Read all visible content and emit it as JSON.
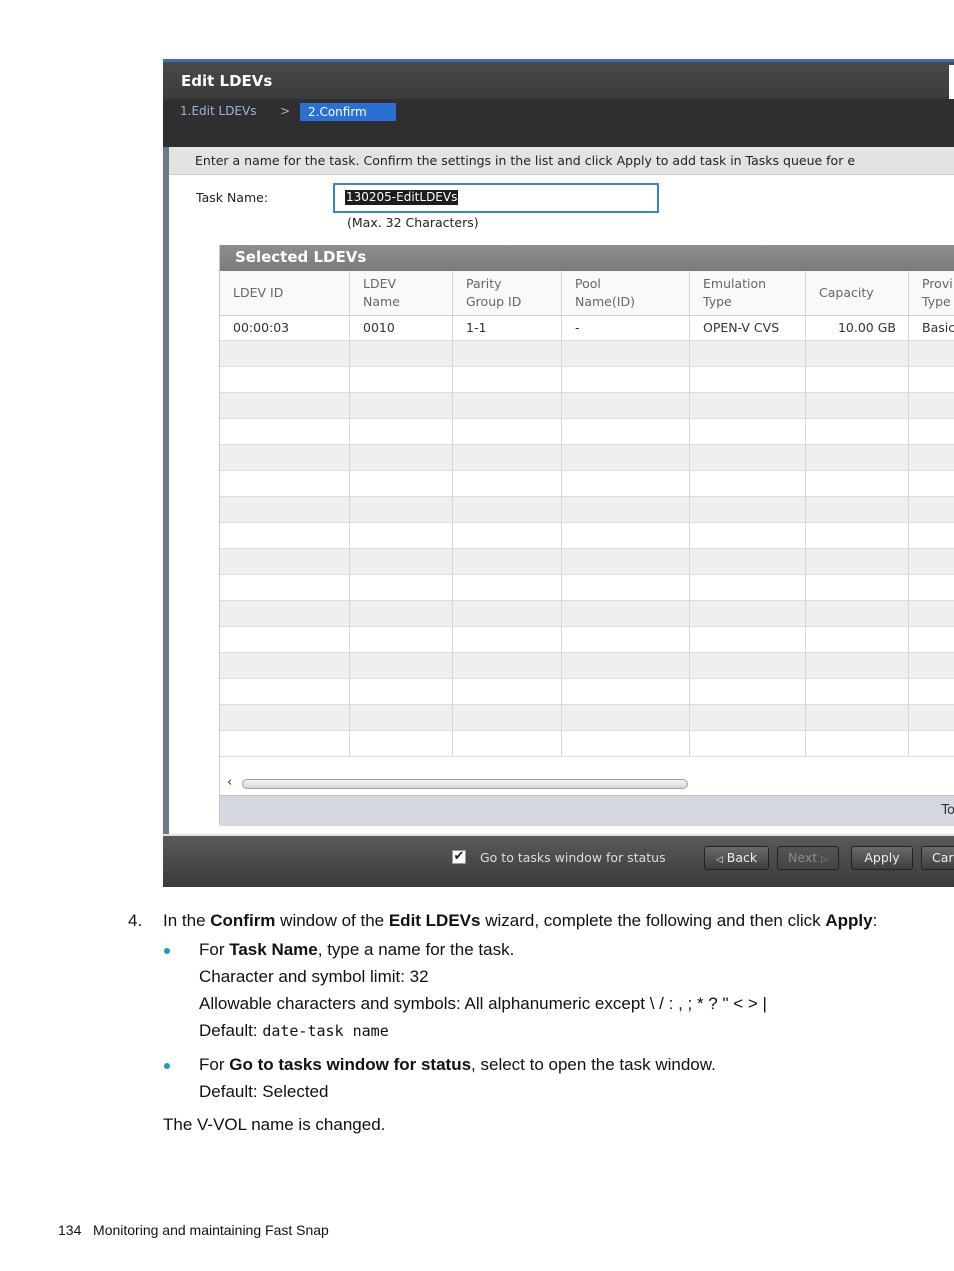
{
  "window": {
    "title": "Edit LDEVs",
    "steps": [
      "1.Edit LDEVs",
      ">",
      "2.Confirm"
    ],
    "instruction": "Enter a name for the task. Confirm the settings in the list and click Apply to add task in Tasks queue for e",
    "task_name_label": "Task Name:",
    "task_name_value": "130205-EditLDEVs",
    "task_name_hint": "(Max. 32 Characters)",
    "table_title": "Selected LDEVs",
    "columns": [
      {
        "line1": "LDEV ID",
        "line2": ""
      },
      {
        "line1": "LDEV",
        "line2": "Name"
      },
      {
        "line1": "Parity",
        "line2": "Group ID"
      },
      {
        "line1": "Pool",
        "line2": "Name(ID)"
      },
      {
        "line1": "Emulation",
        "line2": "Type"
      },
      {
        "line1": "Capacity",
        "line2": ""
      },
      {
        "line1": "Provi",
        "line2": "Type"
      }
    ],
    "rows": [
      [
        "00:00:03",
        "0010",
        "1-1",
        "-",
        "OPEN-V CVS",
        "10.00 GB",
        "Basic"
      ]
    ],
    "scroll_left_arrow": "‹",
    "table_footer": "To",
    "go_to_tasks_label": "Go to tasks window for status",
    "go_to_tasks_checked": true,
    "buttons": {
      "back": "Back",
      "next": "Next",
      "apply": "Apply",
      "cancel": "Car"
    }
  },
  "doc": {
    "step_number": "4.",
    "step_parts": [
      "In the ",
      "Confirm",
      " window of the ",
      "Edit LDEVs",
      " wizard, complete the following and then click ",
      "Apply",
      ":"
    ],
    "bullet1": {
      "prefix": "For ",
      "bold": "Task Name",
      "suffix": ", type a name for the task.",
      "limit": "Character and symbol limit: 32",
      "allowable": "Allowable characters and symbols: All alphanumeric except \\ / : , ; * ? \" < > |",
      "default_label": "Default: ",
      "default_value": "date-task name"
    },
    "bullet2": {
      "prefix": "For ",
      "bold": "Go to tasks window for status",
      "suffix": ", select to open the task window.",
      "default": "Default: Selected"
    },
    "result": "The V-VOL name is changed."
  },
  "footer": {
    "page_number": "134",
    "section": "Monitoring and maintaining Fast Snap"
  },
  "colors": {
    "accent_blue": "#2a70d4",
    "bullet_blue": "#2a8fd0"
  }
}
